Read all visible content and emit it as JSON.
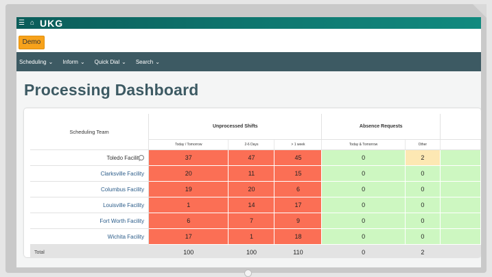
{
  "app": {
    "logo": "UKG",
    "demo_button": "Demo"
  },
  "nav": {
    "items": [
      {
        "label": "Scheduling"
      },
      {
        "label": "Inform"
      },
      {
        "label": "Quick Dial"
      },
      {
        "label": "Search"
      }
    ]
  },
  "page": {
    "title": "Processing Dashboard"
  },
  "table": {
    "team_header": "Scheduling Team",
    "groups": {
      "unprocessed": "Unprocessed Shifts",
      "absence": "Absence Requests"
    },
    "subheaders": {
      "today_tomorrow": "Today / Tomorrow",
      "days_2_6": "2-6 Days",
      "over_week": "> 1 week",
      "abs_today_tomorrow": "Today & Tomorrow",
      "abs_other": "Other"
    },
    "rows": [
      {
        "facility": "Toledo Facility",
        "today": "37",
        "d26": "47",
        "week": "45",
        "abs_today": "0",
        "abs_other": "2"
      },
      {
        "facility": "Clarksville Facility",
        "today": "20",
        "d26": "11",
        "week": "15",
        "abs_today": "0",
        "abs_other": "0"
      },
      {
        "facility": "Columbus Facility",
        "today": "19",
        "d26": "20",
        "week": "6",
        "abs_today": "0",
        "abs_other": "0"
      },
      {
        "facility": "Louisville Facility",
        "today": "1",
        "d26": "14",
        "week": "17",
        "abs_today": "0",
        "abs_other": "0"
      },
      {
        "facility": "Fort Worth Facility",
        "today": "6",
        "d26": "7",
        "week": "9",
        "abs_today": "0",
        "abs_other": "0"
      },
      {
        "facility": "Wichita Facility",
        "today": "17",
        "d26": "1",
        "week": "18",
        "abs_today": "0",
        "abs_other": "0"
      }
    ],
    "total": {
      "label": "Total",
      "today": "100",
      "d26": "100",
      "week": "110",
      "abs_today": "0",
      "abs_other": "2"
    }
  },
  "colors": {
    "red": "#fb6f55",
    "green": "#cdf7c1",
    "yellow": "#fde8b3",
    "nav": "#3d5a63",
    "header": "#0f7a72",
    "demo": "#f7a21b"
  }
}
